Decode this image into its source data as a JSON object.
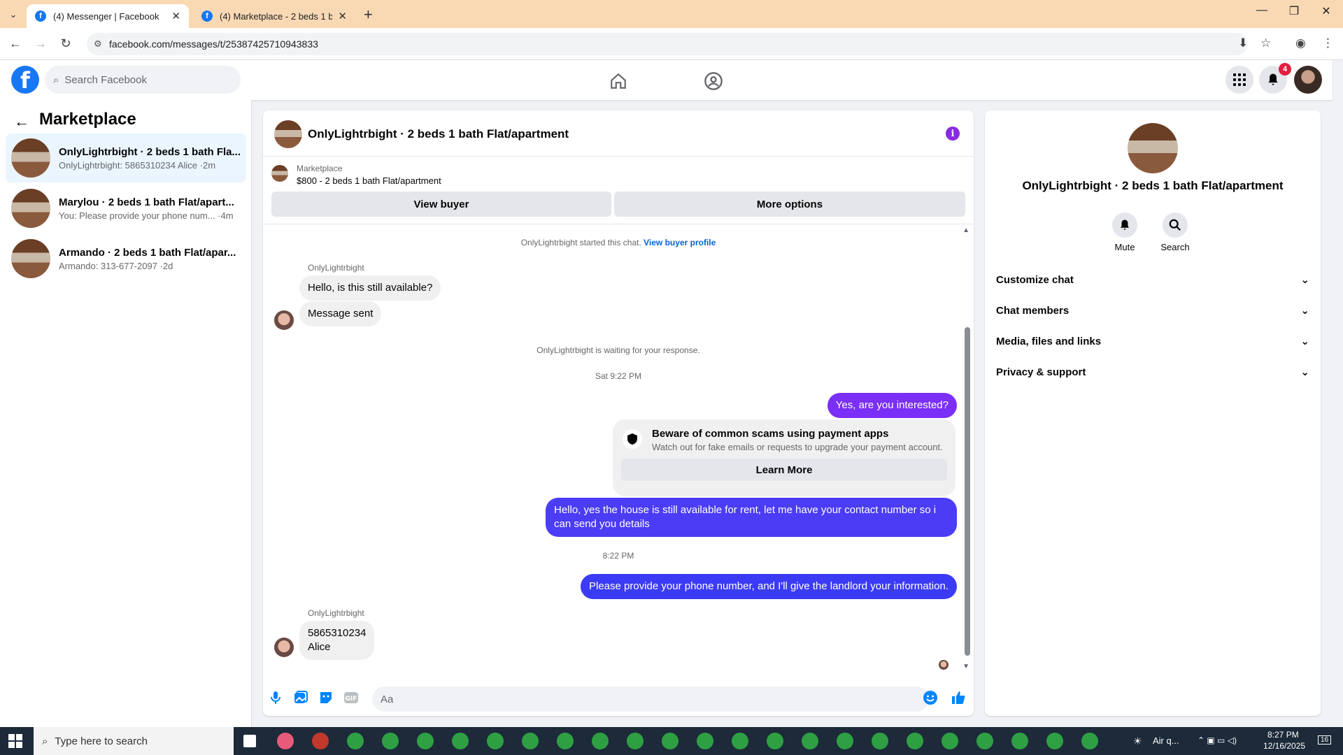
{
  "browser": {
    "tabs": [
      {
        "label": "(4) Messenger | Facebook",
        "active": true
      },
      {
        "label": "(4) Marketplace - 2 beds 1 bath",
        "active": false
      }
    ],
    "url": "facebook.com/messages/t/25387425710943833"
  },
  "fb_header": {
    "search_placeholder": "Search Facebook",
    "notification_count": "4",
    "colors": {
      "brand": "#1877f2",
      "badge": "#e41e3f"
    }
  },
  "left": {
    "title": "Marketplace",
    "conversations": [
      {
        "name": "OnlyLightrbight · 2 beds 1 bath Fla...",
        "preview": "OnlyLightrbight: 5865310234 Alice ·2m"
      },
      {
        "name": "Marylou · 2 beds 1 bath Flat/apart...",
        "preview": "You: Please provide your phone num... ·4m"
      },
      {
        "name": "Armando · 2 beds 1 bath Flat/apar...",
        "preview": "Armando: 313-677-2097 ·2d"
      }
    ]
  },
  "chat": {
    "title": "OnlyLightrbight · 2 beds 1 bath Flat/apartment",
    "marketplace_label": "Marketplace",
    "listing": "$800 - 2 beds 1 bath Flat/apartment",
    "view_buyer": "View buyer",
    "more_options": "More options",
    "started_text": "OnlyLightrbight started this chat.",
    "view_profile": "View buyer profile",
    "sender_name_1": "OnlyLightrbight",
    "msg_in_1": "Hello, is this still available?",
    "msg_in_2": "Message sent",
    "waiting_text": "OnlyLightrbight is waiting for your response.",
    "time_1": "Sat 9:22 PM",
    "msg_out_1": "Yes, are you interested?",
    "warning_title": "Beware of common scams using payment apps",
    "warning_sub": "Watch out for fake emails or requests to upgrade your payment account.",
    "learn_more": "Learn More",
    "msg_out_2": "Hello, yes the house is still available for rent, let me have your contact number so i can send you details",
    "time_2": "8:22 PM",
    "msg_out_3": "Please provide your phone number, and I'll give the landlord your information.",
    "sender_name_2": "OnlyLightrbight",
    "msg_in_3_line1": "5865310234",
    "msg_in_3_line2": "Alice",
    "composer_placeholder": "Aa",
    "colors": {
      "out_purple": "#7b2ff7",
      "out_blue": "#3b3bf5",
      "accent": "#0084ff"
    }
  },
  "right": {
    "title": "OnlyLightrbight · 2 beds 1 bath Flat/apartment",
    "mute": "Mute",
    "search": "Search",
    "sections": [
      "Customize chat",
      "Chat members",
      "Media, files and links",
      "Privacy & support"
    ]
  },
  "taskbar": {
    "search_placeholder": "Type here to search",
    "weather": "Air q...",
    "time": "8:27 PM",
    "date": "12/16/2025",
    "notif_count": "16"
  }
}
